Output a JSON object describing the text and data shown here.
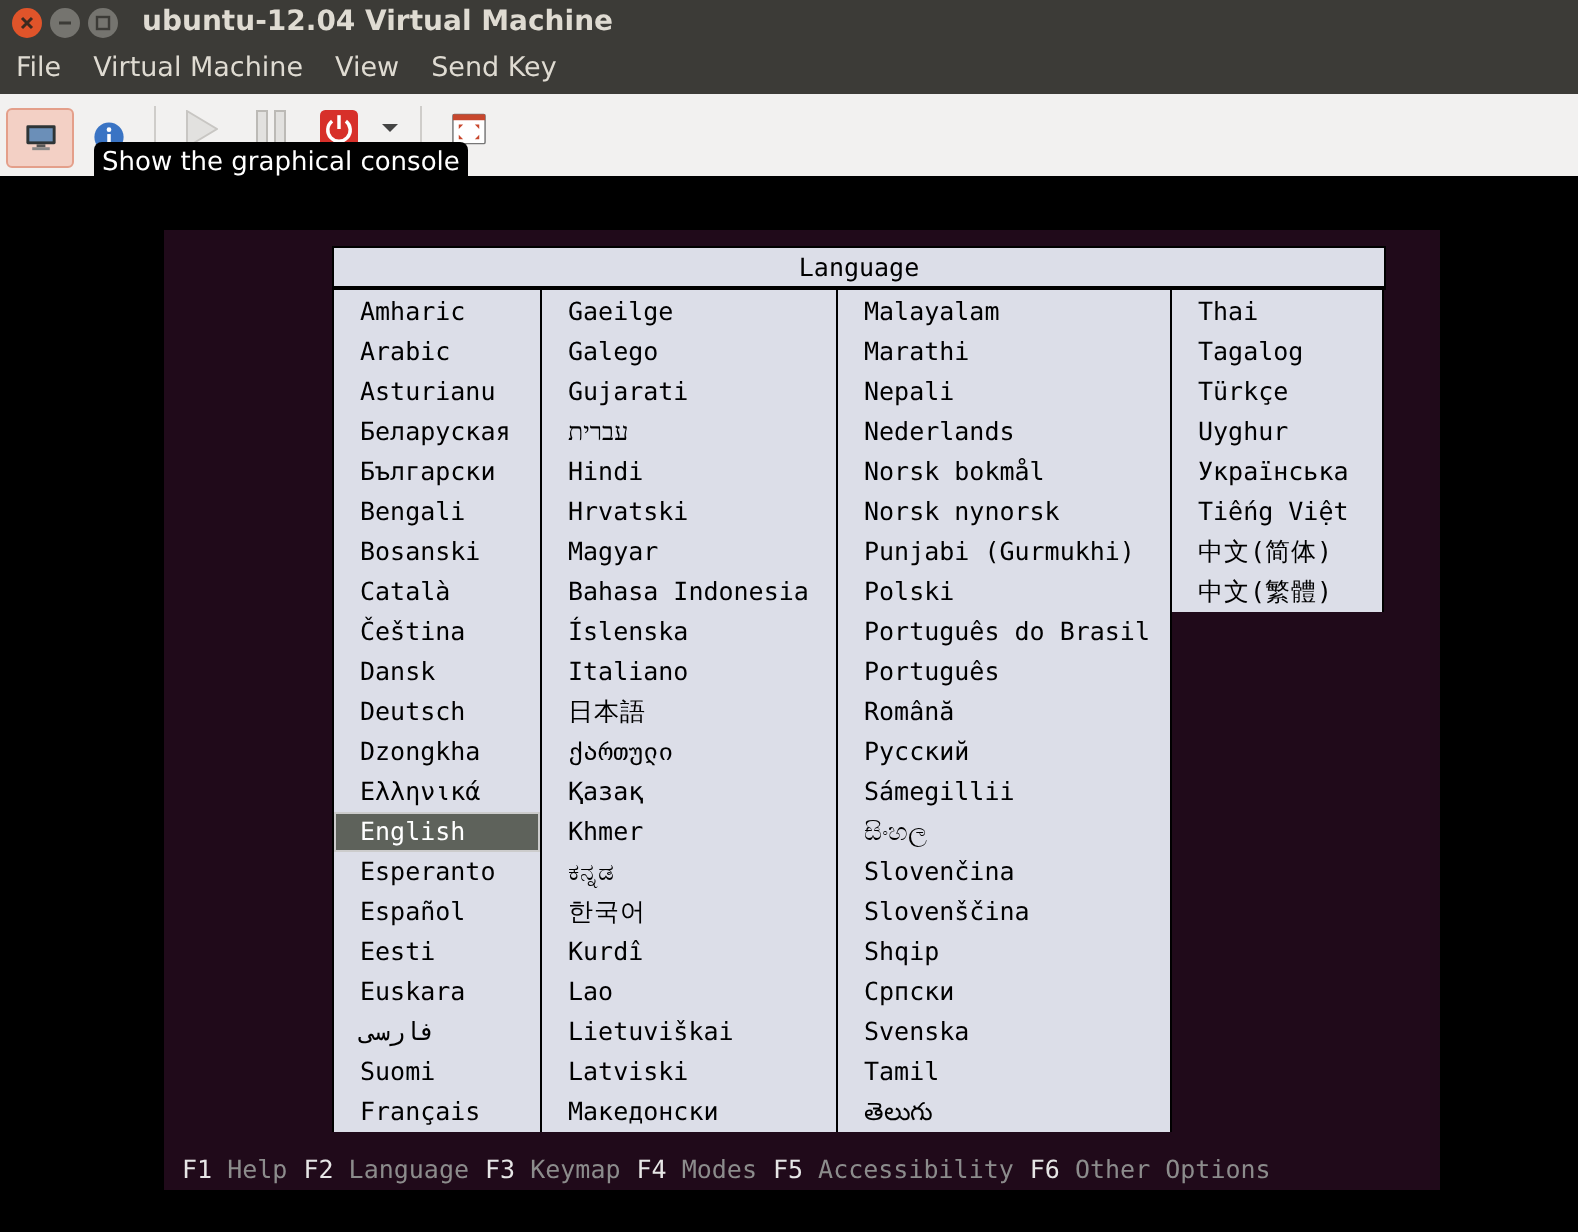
{
  "window": {
    "title": "ubuntu-12.04 Virtual Machine"
  },
  "menu": [
    "File",
    "Virtual Machine",
    "View",
    "Send Key"
  ],
  "toolbar": {
    "views": [
      {
        "kind": "console",
        "selected": true
      },
      {
        "kind": "details",
        "selected": false
      }
    ],
    "actions": [
      {
        "kind": "run"
      },
      {
        "kind": "pause"
      },
      {
        "kind": "shutdown"
      },
      {
        "kind": "dropdown"
      },
      {
        "kind": "fullscreen"
      }
    ],
    "tooltip": "Show the graphical console"
  },
  "installer": {
    "title": "Language",
    "columns": [
      [
        {
          "label": "Amharic",
          "selected": false
        },
        {
          "label": "Arabic",
          "selected": false
        },
        {
          "label": "Asturianu",
          "selected": false
        },
        {
          "label": "Беларуская",
          "selected": false
        },
        {
          "label": "Български",
          "selected": false
        },
        {
          "label": "Bengali",
          "selected": false
        },
        {
          "label": "Bosanski",
          "selected": false
        },
        {
          "label": "Català",
          "selected": false
        },
        {
          "label": "Čeština",
          "selected": false
        },
        {
          "label": "Dansk",
          "selected": false
        },
        {
          "label": "Deutsch",
          "selected": false
        },
        {
          "label": "Dzongkha",
          "selected": false
        },
        {
          "label": "Ελληνικά",
          "selected": false
        },
        {
          "label": "English",
          "selected": true
        },
        {
          "label": "Esperanto",
          "selected": false
        },
        {
          "label": "Español",
          "selected": false
        },
        {
          "label": "Eesti",
          "selected": false
        },
        {
          "label": "Euskara",
          "selected": false
        },
        {
          "label": "فارسی",
          "selected": false
        },
        {
          "label": "Suomi",
          "selected": false
        },
        {
          "label": "Français",
          "selected": false
        }
      ],
      [
        {
          "label": "Gaeilge",
          "selected": false
        },
        {
          "label": "Galego",
          "selected": false
        },
        {
          "label": "Gujarati",
          "selected": false
        },
        {
          "label": "עברית",
          "selected": false
        },
        {
          "label": "Hindi",
          "selected": false
        },
        {
          "label": "Hrvatski",
          "selected": false
        },
        {
          "label": "Magyar",
          "selected": false
        },
        {
          "label": "Bahasa Indonesia",
          "selected": false
        },
        {
          "label": "Íslenska",
          "selected": false
        },
        {
          "label": "Italiano",
          "selected": false
        },
        {
          "label": "日本語",
          "selected": false
        },
        {
          "label": "ქართული",
          "selected": false
        },
        {
          "label": "Қазақ",
          "selected": false
        },
        {
          "label": "Khmer",
          "selected": false
        },
        {
          "label": "ಕನ್ನಡ",
          "selected": false
        },
        {
          "label": "한국어",
          "selected": false
        },
        {
          "label": "Kurdî",
          "selected": false
        },
        {
          "label": "Lao",
          "selected": false
        },
        {
          "label": "Lietuviškai",
          "selected": false
        },
        {
          "label": "Latviski",
          "selected": false
        },
        {
          "label": "Македонски",
          "selected": false
        }
      ],
      [
        {
          "label": "Malayalam",
          "selected": false
        },
        {
          "label": "Marathi",
          "selected": false
        },
        {
          "label": "Nepali",
          "selected": false
        },
        {
          "label": "Nederlands",
          "selected": false
        },
        {
          "label": "Norsk bokmål",
          "selected": false
        },
        {
          "label": "Norsk nynorsk",
          "selected": false
        },
        {
          "label": "Punjabi (Gurmukhi)",
          "selected": false
        },
        {
          "label": "Polski",
          "selected": false
        },
        {
          "label": "Português do Brasil",
          "selected": false
        },
        {
          "label": "Português",
          "selected": false
        },
        {
          "label": "Română",
          "selected": false
        },
        {
          "label": "Русский",
          "selected": false
        },
        {
          "label": "Sámegillii",
          "selected": false
        },
        {
          "label": "සිංහල",
          "selected": false
        },
        {
          "label": "Slovenčina",
          "selected": false
        },
        {
          "label": "Slovenščina",
          "selected": false
        },
        {
          "label": "Shqip",
          "selected": false
        },
        {
          "label": "Српски",
          "selected": false
        },
        {
          "label": "Svenska",
          "selected": false
        },
        {
          "label": "Tamil",
          "selected": false
        },
        {
          "label": "తెలుగు",
          "selected": false
        }
      ],
      [
        {
          "label": "Thai",
          "selected": false
        },
        {
          "label": "Tagalog",
          "selected": false
        },
        {
          "label": "Türkçe",
          "selected": false
        },
        {
          "label": "Uyghur",
          "selected": false
        },
        {
          "label": "Українська",
          "selected": false
        },
        {
          "label": "Tiếng Việt",
          "selected": false
        },
        {
          "label": "中文(简体)",
          "selected": false
        },
        {
          "label": "中文(繁體)",
          "selected": false
        }
      ]
    ]
  },
  "function_keys": [
    {
      "key": "F1",
      "label": "Help"
    },
    {
      "key": "F2",
      "label": "Language"
    },
    {
      "key": "F3",
      "label": "Keymap"
    },
    {
      "key": "F4",
      "label": "Modes"
    },
    {
      "key": "F5",
      "label": "Accessibility"
    },
    {
      "key": "F6",
      "label": "Other Options"
    }
  ]
}
